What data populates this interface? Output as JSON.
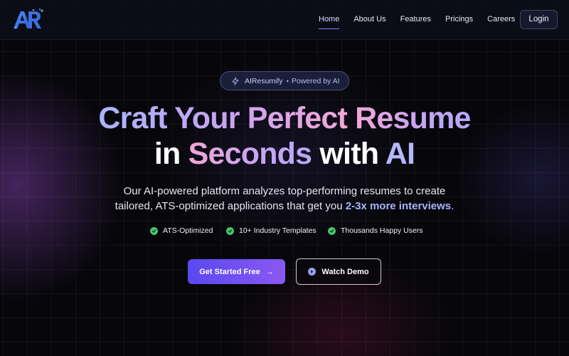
{
  "nav": {
    "links": [
      {
        "label": "Home",
        "active": true
      },
      {
        "label": "About Us"
      },
      {
        "label": "Features"
      },
      {
        "label": "Pricings"
      },
      {
        "label": "Careers"
      }
    ],
    "login_label": "Login",
    "logo_icon": "ar-logo-icon"
  },
  "badge": {
    "icon": "lightning-icon",
    "name": "AIResumify",
    "separator": "•",
    "tagline": "Powered by AI"
  },
  "headline": {
    "line1": {
      "part1": "Craft Your Perfect ",
      "part2": "Resume"
    },
    "line2": {
      "part1": "in ",
      "part2": "Seconds",
      "part3": " with ",
      "part4": "AI"
    }
  },
  "subtext": {
    "line1": "Our AI-powered platform analyzes top-performing resumes to create",
    "line2_prefix": "tailored, ATS-optimized applications that get you ",
    "line2_highlight": "2-3x more interviews",
    "line2_suffix": "."
  },
  "features": [
    {
      "label": "ATS-Optimized",
      "icon": "check-circle-icon"
    },
    {
      "label": "10+ Industry Templates",
      "icon": "check-circle-icon"
    },
    {
      "label": "Thousands Happy Users",
      "icon": "check-circle-icon"
    }
  ],
  "cta": {
    "primary_label": "Get Started Free",
    "primary_icon": "arrow-right-icon",
    "secondary_label": "Watch Demo",
    "secondary_icon": "play-circle-icon"
  },
  "colors": {
    "accent": "#7d84ff",
    "primary_button_start": "#5a48f0",
    "primary_button_end": "#8a58f2",
    "check": "#47c46e",
    "background": "#07070b"
  }
}
